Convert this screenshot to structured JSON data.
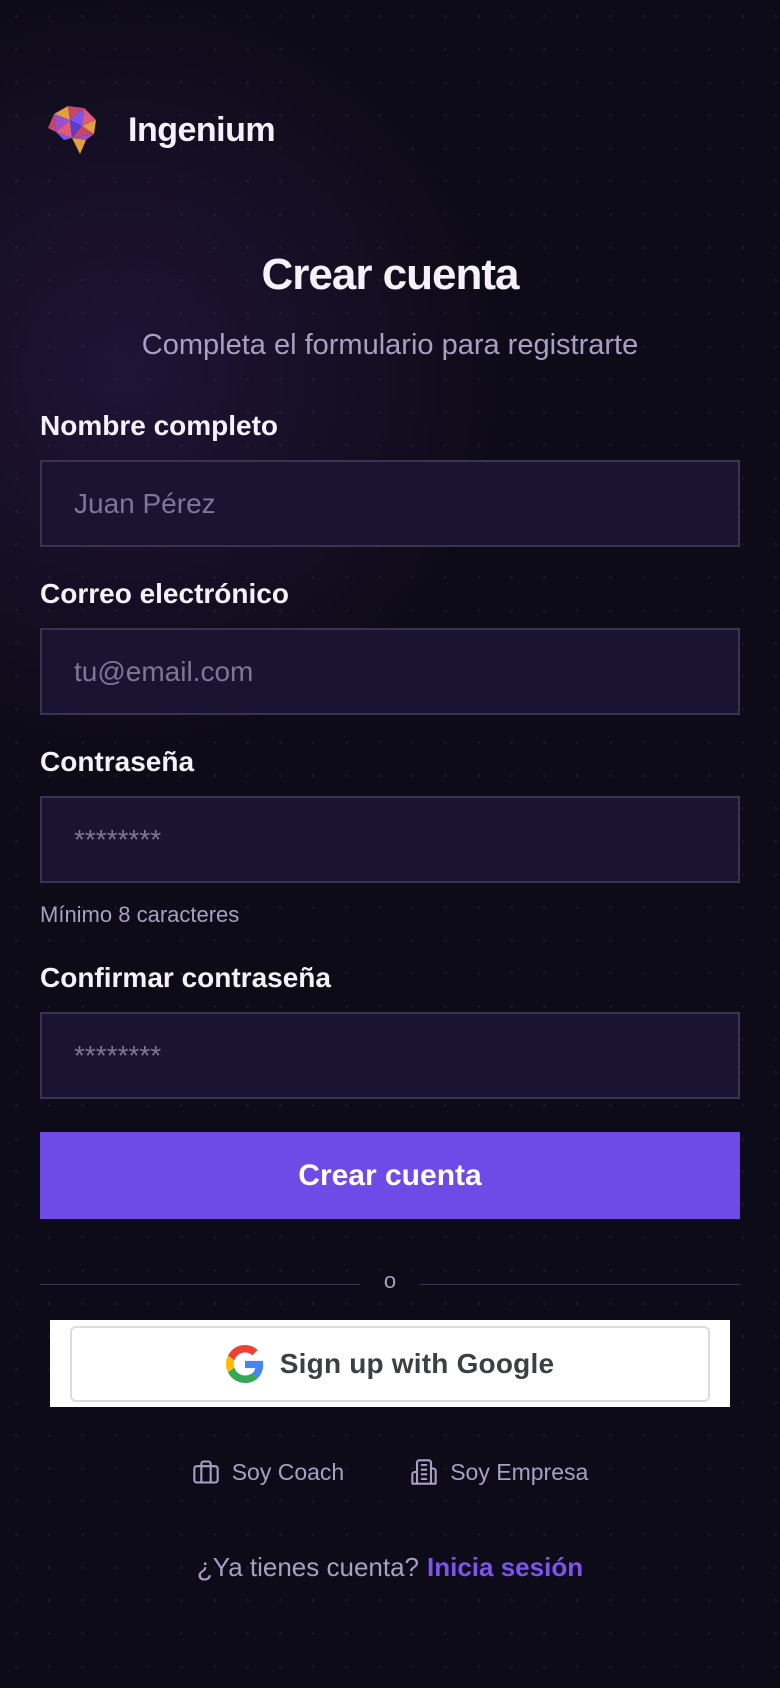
{
  "brand": {
    "name": "Ingenium",
    "logo_icon": "brain-icon"
  },
  "header": {
    "title": "Crear cuenta",
    "subtitle": "Completa el formulario para registrarte"
  },
  "form": {
    "name": {
      "label": "Nombre completo",
      "placeholder": "Juan Pérez",
      "value": ""
    },
    "email": {
      "label": "Correo electrónico",
      "placeholder": "tu@email.com",
      "value": ""
    },
    "password": {
      "label": "Contraseña",
      "placeholder": "********",
      "hint": "Mínimo 8 caracteres",
      "value": ""
    },
    "confirm_password": {
      "label": "Confirmar contraseña",
      "placeholder": "********",
      "value": ""
    },
    "submit_label": "Crear cuenta"
  },
  "divider": {
    "text": "o"
  },
  "google": {
    "label": "Sign up with Google",
    "icon": "google-icon"
  },
  "roles": {
    "coach": {
      "label": "Soy Coach",
      "icon": "briefcase-icon"
    },
    "company": {
      "label": "Soy Empresa",
      "icon": "building-icon"
    }
  },
  "signin": {
    "prompt": "¿Ya tienes cuenta?",
    "link": "Inicia sesión"
  },
  "colors": {
    "background": "#0e0b18",
    "input_bg": "#1b1430",
    "accent": "#6e4ae6",
    "link": "#7b55ee",
    "muted_text": "#a99fc2"
  }
}
